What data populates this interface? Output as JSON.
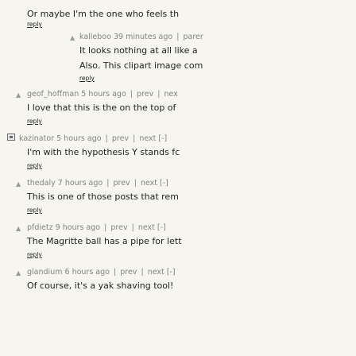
{
  "top_partial": "...",
  "comments": [
    {
      "user": "",
      "age": "",
      "text": "Or maybe I'm the one who feels th",
      "reply": "reply",
      "has_meta": false
    },
    {
      "user": "kalleboo",
      "age": "39 minutes ago",
      "links": [
        "parer"
      ],
      "text": "It looks nothing at all like a",
      "text2": "Also. This clipart image com",
      "reply": "reply"
    },
    {
      "user": "geof_hoffman",
      "age": "5 hours ago",
      "links": [
        "prev",
        "nex"
      ],
      "text": "I love that this is the on the top of",
      "reply": "reply"
    },
    {
      "user": "kazinator",
      "age": "5 hours ago",
      "links": [
        "prev",
        "next",
        "[-]"
      ],
      "text": "I'm with the hypothesis Y stands fc",
      "reply": "reply"
    },
    {
      "user": "thedaly",
      "age": "7 hours ago",
      "links": [
        "prev",
        "next",
        "[-]"
      ],
      "text": "This is one of those posts that rem",
      "reply": "reply"
    },
    {
      "user": "pfdietz",
      "age": "9 hours ago",
      "links": [
        "prev",
        "next",
        "[-]"
      ],
      "text": "The Magritte ball has a pipe for lett",
      "reply": "reply"
    },
    {
      "user": "glandium",
      "age": "6 hours ago",
      "links": [
        "prev",
        "next",
        "[-]"
      ],
      "text": "Of course, it's a yak shaving tool!",
      "reply": ""
    }
  ],
  "icons": {
    "arrow": "upvote-arrow-icon",
    "flag": "flag-icon"
  },
  "colors": {
    "background": "#f6f6ef",
    "meta": "#828282",
    "text": "#222222"
  }
}
